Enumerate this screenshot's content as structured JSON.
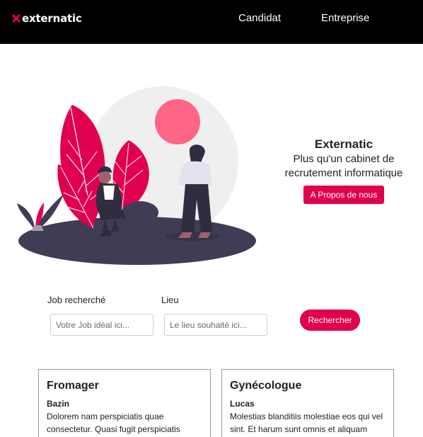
{
  "navbar": {
    "brand": "externatic",
    "links": [
      {
        "label": "Candidat"
      },
      {
        "label": "Entreprise"
      }
    ]
  },
  "hero": {
    "title": "Externatic",
    "subtitle": "Plus qu'un cabinet de recrutement informatique",
    "button_label": "A Propos de nous"
  },
  "search": {
    "job_label": "Job recherché",
    "job_placeholder": "Votre Job idéal ici...",
    "lieu_label": "Lieu",
    "lieu_placeholder": "Le lieu souhaité ici...",
    "button_label": "Rechercher"
  },
  "jobs": [
    {
      "title": "Fromager",
      "company": "Bazin",
      "description": "Dolorem nam perspiciatis quae consectetur. Quasi fugit perspiciatis"
    },
    {
      "title": "Gynécologue",
      "company": "Lucas",
      "description": "Molestias blanditiis molestiae eos qui vel sint. Et harum sunt omnis et aliquam"
    }
  ],
  "colors": {
    "accent": "#e0004f",
    "navbar_bg": "#000000",
    "illustration_dark": "#3f3d56",
    "illustration_pink": "#ff6584"
  }
}
